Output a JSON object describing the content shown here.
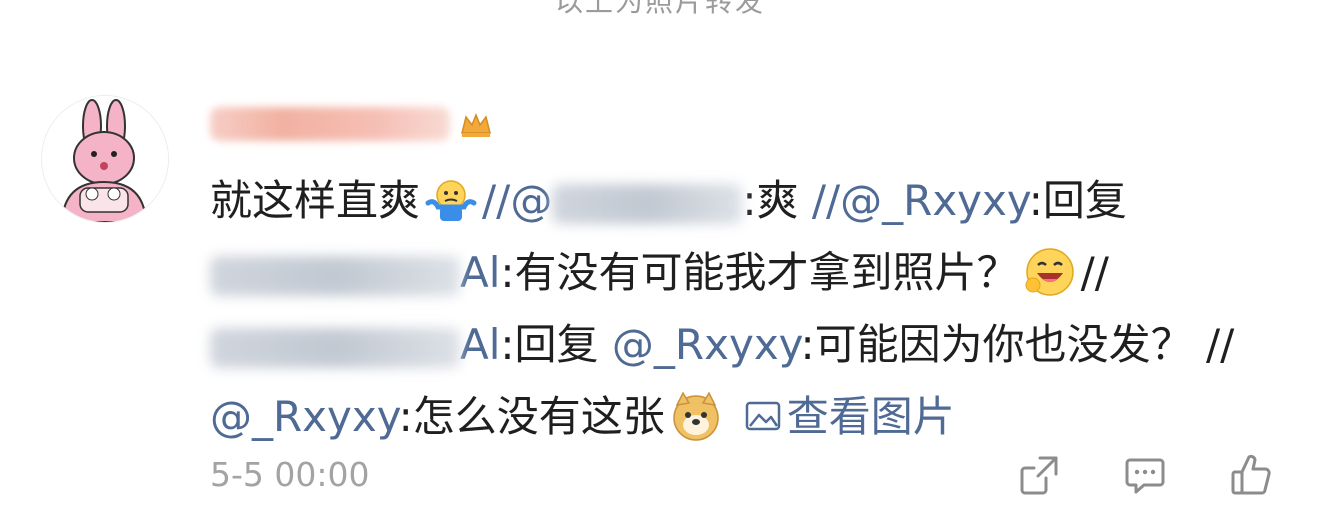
{
  "top_note": "以上为照片转发",
  "comment": {
    "line1_text": "就这样直爽",
    "mention_user2_prefix": "//@",
    "after_blur_1": ":爽",
    "mention_rxyxy_1": "//@_Rxyxy",
    "reply_1": ":回复",
    "line2_suffix_user": "Al",
    "line2_text": ":有没有可能我才拿到照片？",
    "sep_1": "//",
    "line3_suffix_user": "Al",
    "reply_2": ":回复",
    "mention_rxyxy_2": "@_Rxyxy",
    "line3_text": ":可能因为你也没发？",
    "sep_2": "//",
    "mention_rxyxy_3": "@_Rxyxy",
    "line4_text": ":怎么没有这张",
    "view_image_label": "查看图片"
  },
  "timestamp": "5-5 00:00",
  "icons": {
    "emoji_shrug": "shrug-emoji-icon",
    "emoji_haha": "haha-emoji-icon",
    "emoji_doge": "doge-emoji-icon",
    "image": "image-icon",
    "repost": "repost-icon",
    "comment": "comment-icon",
    "like": "like-icon"
  },
  "colors": {
    "mention": "#4f6a94",
    "text": "#1f1f1f",
    "muted": "#a3a3a3"
  }
}
